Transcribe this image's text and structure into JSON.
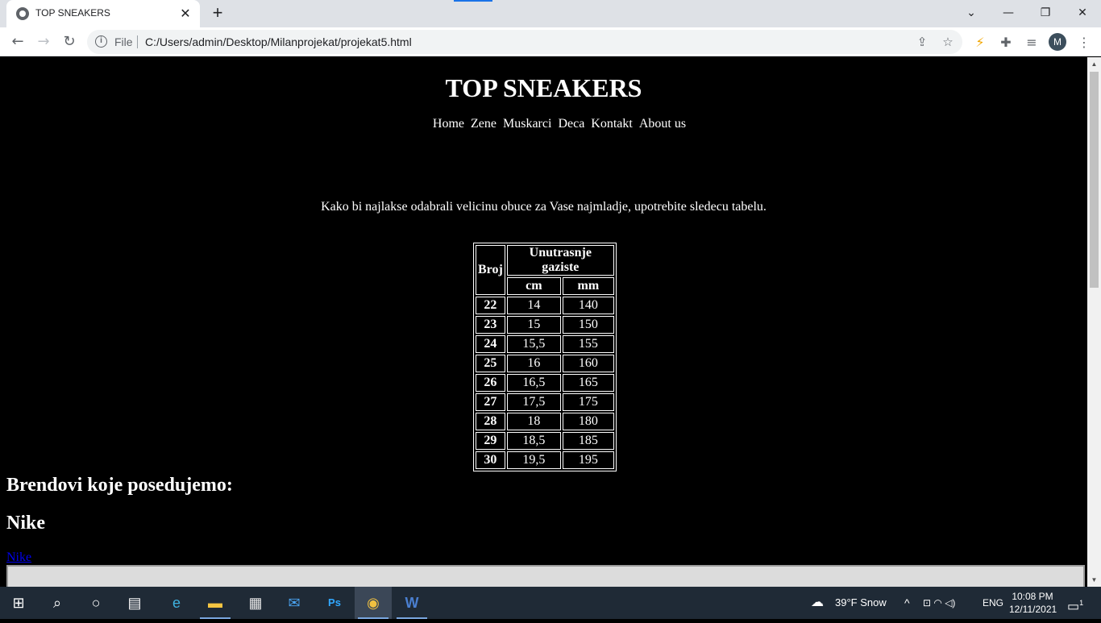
{
  "browser": {
    "tab_title": "TOP SNEAKERS",
    "tab_close": "✕",
    "new_tab": "+",
    "window": {
      "dropdown": "⌄",
      "minimize": "—",
      "restore": "❐",
      "close": "✕"
    },
    "nav": {
      "back": "←",
      "forward": "→",
      "reload": "↻"
    },
    "omnibox": {
      "info": "i",
      "scheme_label": "File",
      "url": "C:/Users/admin/Desktop/Milanprojekat/projekat5.html",
      "share": "⇪",
      "bookmark": "☆"
    },
    "extensions": {
      "bolt": "⚡",
      "puzzle": "✚",
      "media": "≡",
      "profile_initial": "M",
      "menu": "⋮"
    }
  },
  "page": {
    "title": "TOP SNEAKERS",
    "nav": [
      "Home",
      "Zene",
      "Muskarci",
      "Deca",
      "Kontakt",
      "About us"
    ],
    "intro": "Kako bi najlakse odabrali velicinu obuce za Vase najmladje, upotrebite sledecu tabelu.",
    "size_table": {
      "col_broj": "Broj",
      "col_group": "Unutrasnje gaziste",
      "col_cm": "cm",
      "col_mm": "mm",
      "rows": [
        {
          "broj": "22",
          "cm": "14",
          "mm": "140"
        },
        {
          "broj": "23",
          "cm": "15",
          "mm": "150"
        },
        {
          "broj": "24",
          "cm": "15,5",
          "mm": "155"
        },
        {
          "broj": "25",
          "cm": "16",
          "mm": "160"
        },
        {
          "broj": "26",
          "cm": "16,5",
          "mm": "165"
        },
        {
          "broj": "27",
          "cm": "17,5",
          "mm": "175"
        },
        {
          "broj": "28",
          "cm": "18",
          "mm": "180"
        },
        {
          "broj": "29",
          "cm": "18,5",
          "mm": "185"
        },
        {
          "broj": "30",
          "cm": "19,5",
          "mm": "195"
        }
      ]
    },
    "brands_heading": "Brendovi koje posedujemo:",
    "nike_heading": "Nike",
    "nike_link": "Nike"
  },
  "taskbar": {
    "start": "⊞",
    "search": "⌕",
    "task_view": "○",
    "widgets": "▤",
    "edge": "e",
    "explorer": "▬",
    "store": "▦",
    "mail": "✉",
    "photoshop": "Ps",
    "chrome": "◉",
    "word": "W",
    "weather": "39°F  Snow",
    "tray_chevron": "^",
    "tray_icons": "⊡ ◠ ◁)",
    "language": "ENG",
    "time": "10:08 PM",
    "date": "12/11/2021",
    "notifications": "1"
  }
}
